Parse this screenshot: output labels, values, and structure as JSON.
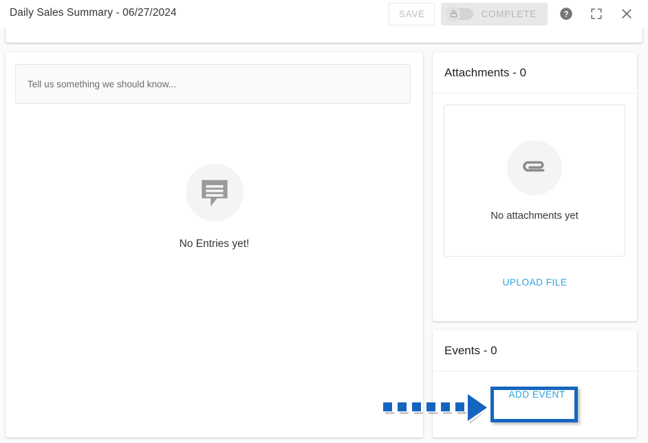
{
  "header": {
    "title": "Daily Sales Summary - 06/27/2024",
    "save_label": "SAVE",
    "complete_label": "COMPLETE",
    "toggle_icon": "lock-icon",
    "help_icon": "help-circle-icon",
    "fullscreen_icon": "fullscreen-icon",
    "close_icon": "close-icon"
  },
  "entries_panel": {
    "input_placeholder": "Tell us something we should know...",
    "empty_icon": "comment-bubble-icon",
    "empty_text": "No Entries yet!"
  },
  "attachments_panel": {
    "title": "Attachments - 0",
    "empty_icon": "paperclip-icon",
    "empty_text": "No attachments yet",
    "upload_label": "UPLOAD FILE"
  },
  "events_panel": {
    "title": "Events - 0",
    "add_event_label": "ADD EVENT"
  },
  "annotation": {
    "type": "dashed-arrow-pointing-right",
    "target": "add-event-button",
    "dash_count": 6,
    "color": "#1565c0"
  },
  "colors": {
    "accent_link": "#29a3e0",
    "annotation_blue": "#1565c0",
    "page_background": "#fafafa",
    "card_background": "#ffffff",
    "icon_gray": "#8c8c8c",
    "text_primary": "#212121",
    "text_muted": "#bdbdbd"
  }
}
